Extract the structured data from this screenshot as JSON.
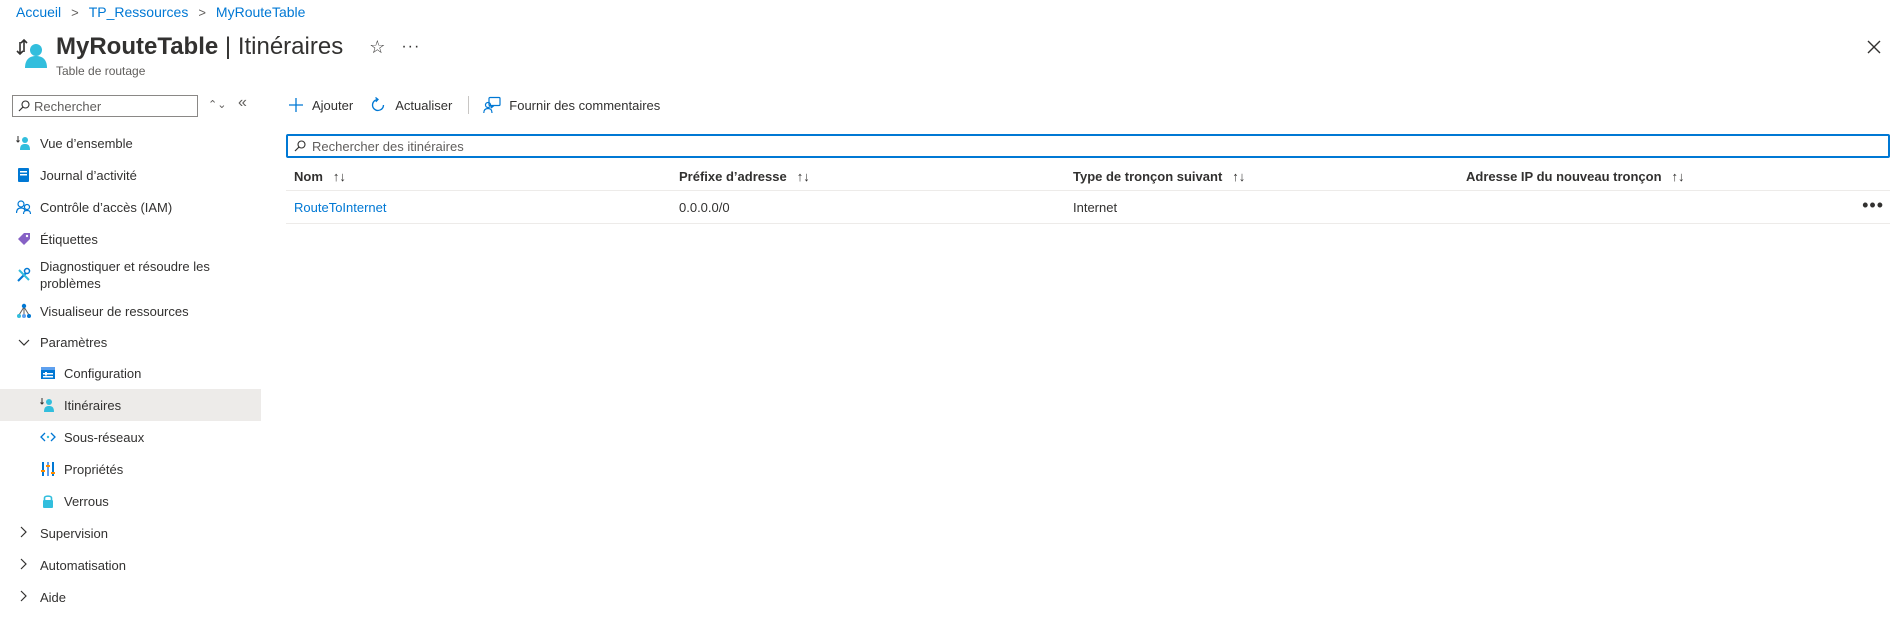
{
  "breadcrumb": [
    "Accueil",
    "TP_Ressources",
    "MyRouteTable"
  ],
  "header": {
    "resource_name": "MyRouteTable",
    "separator": " | ",
    "page_name": "Itinéraires",
    "subtitle": "Table de routage",
    "star_icon": "☆",
    "more_icon": "···"
  },
  "sidebar": {
    "search_placeholder": "Rechercher",
    "items": [
      {
        "label": "Vue d’ensemble",
        "icon": "overview-icon"
      },
      {
        "label": "Journal d’activité",
        "icon": "activity-log-icon"
      },
      {
        "label": "Contrôle d’accès (IAM)",
        "icon": "iam-icon"
      },
      {
        "label": "Étiquettes",
        "icon": "tag-icon"
      },
      {
        "label": "Diagnostiquer et résoudre les",
        "label2": "problèmes",
        "icon": "wrench-icon"
      },
      {
        "label": "Visualiseur de ressources",
        "icon": "resource-visualizer-icon"
      },
      {
        "label": "Paramètres",
        "icon": "chevron-down-icon"
      },
      {
        "label": "Configuration",
        "icon": "configuration-icon"
      },
      {
        "label": "Itinéraires",
        "icon": "routes-icon",
        "selected": true
      },
      {
        "label": "Sous-réseaux",
        "icon": "subnets-icon"
      },
      {
        "label": "Propriétés",
        "icon": "properties-icon"
      },
      {
        "label": "Verrous",
        "icon": "lock-icon"
      },
      {
        "label": "Supervision",
        "icon": "chevron-right-icon"
      },
      {
        "label": "Automatisation",
        "icon": "chevron-right-icon"
      },
      {
        "label": "Aide",
        "icon": "chevron-right-icon"
      }
    ]
  },
  "toolbar": {
    "add_label": "Ajouter",
    "refresh_label": "Actualiser",
    "feedback_label": "Fournir des commentaires"
  },
  "search": {
    "placeholder": "Rechercher des itinéraires"
  },
  "table": {
    "columns": [
      "Nom",
      "Préfixe d’adresse",
      "Type de tronçon suivant",
      "Adresse IP du nouveau tronçon"
    ],
    "sort_icon": "↑↓",
    "rows": [
      {
        "name": "RouteToInternet",
        "prefix": "0.0.0.0/0",
        "next_hop_type": "Internet",
        "next_hop_ip": ""
      }
    ]
  },
  "colors": {
    "accent": "#0078d4",
    "selected_bg": "#edebe9",
    "text": "#323130"
  }
}
